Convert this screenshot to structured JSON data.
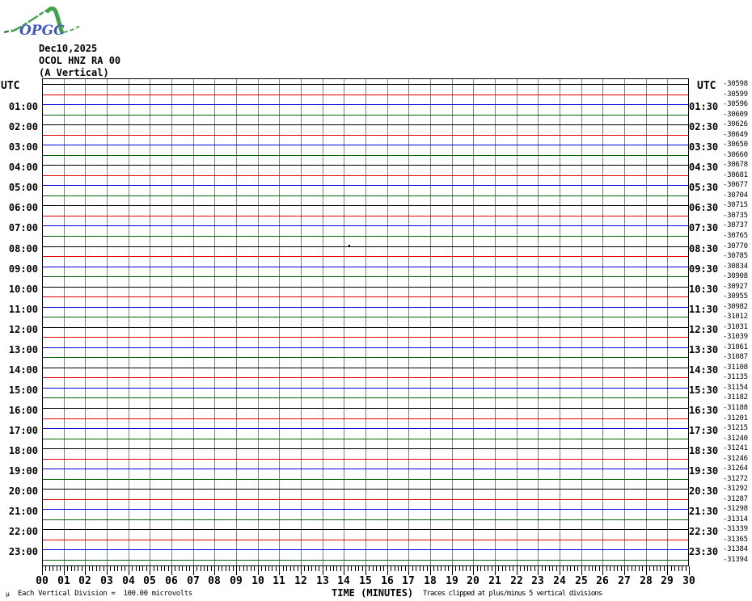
{
  "logo": {
    "text": "OPGC"
  },
  "header": {
    "date": "Dec10,2025",
    "station": "OCOL HNZ RA 00",
    "component": "(A Vertical)"
  },
  "corner_labels": {
    "left": "UTC",
    "right": "UTC"
  },
  "footer": {
    "unit_glyph": "µ"
  },
  "colors": {
    "trace_cycle": [
      "#000000",
      "#e00000",
      "#0000dd",
      "#006400"
    ],
    "grid": "#808080",
    "frame": "#000000",
    "logo_green": "#3fa14b",
    "logo_dark_green": "#2a7a33",
    "logo_blue": "#4157bd"
  },
  "chart_data": {
    "type": "line",
    "subtype": "helicorder-webicorder",
    "title": "OCOL HNZ RA 00 (A Vertical) Dec10,2025",
    "xlabel": "TIME (MINUTES)",
    "x_range_minutes": [
      0,
      30
    ],
    "x_tick_labels": [
      "00",
      "01",
      "02",
      "03",
      "04",
      "05",
      "06",
      "07",
      "08",
      "09",
      "10",
      "11",
      "12",
      "13",
      "14",
      "15",
      "16",
      "17",
      "18",
      "19",
      "20",
      "21",
      "22",
      "23",
      "24",
      "25",
      "26",
      "27",
      "28",
      "29",
      "30"
    ],
    "minor_ticks_per_minute": 6,
    "rows": 48,
    "row_duration_minutes": 30,
    "left_hour_labels": [
      "01:00",
      "02:00",
      "03:00",
      "04:00",
      "05:00",
      "06:00",
      "07:00",
      "08:00",
      "09:00",
      "10:00",
      "11:00",
      "12:00",
      "13:00",
      "14:00",
      "15:00",
      "16:00",
      "17:00",
      "18:00",
      "19:00",
      "20:00",
      "21:00",
      "22:00",
      "23:00"
    ],
    "right_half_hour_labels": [
      "01:30",
      "02:30",
      "03:30",
      "04:30",
      "05:30",
      "06:30",
      "07:30",
      "08:30",
      "09:30",
      "10:30",
      "11:30",
      "12:30",
      "13:30",
      "14:30",
      "15:30",
      "16:30",
      "17:30",
      "18:30",
      "19:30",
      "20:30",
      "21:30",
      "22:30",
      "23:30"
    ],
    "bias_values": [
      -30598,
      -30599,
      -30596,
      -30609,
      -30626,
      -30649,
      -30650,
      -30660,
      -30678,
      -30681,
      -30677,
      -30704,
      -30715,
      -30735,
      -30737,
      -30765,
      -30770,
      -30785,
      -30834,
      -30908,
      -30927,
      -30955,
      -30982,
      -31012,
      -31031,
      -31039,
      -31061,
      -31087,
      -31108,
      -31135,
      -31154,
      -31182,
      -31188,
      -31201,
      -31215,
      -31240,
      -31241,
      -31246,
      -31264,
      -31272,
      -31292,
      -31287,
      -31298,
      -31314,
      -31339,
      -31365,
      -31384,
      -31394
    ],
    "signal": "all traces flat (quiet, no visible events)",
    "blip": {
      "row_index": 16,
      "minute": 14.2
    },
    "scale_note": "Each Vertical Division =  100.00 microvolts",
    "clip_note": "Traces clipped at plus/minus 5 vertical divisions"
  }
}
